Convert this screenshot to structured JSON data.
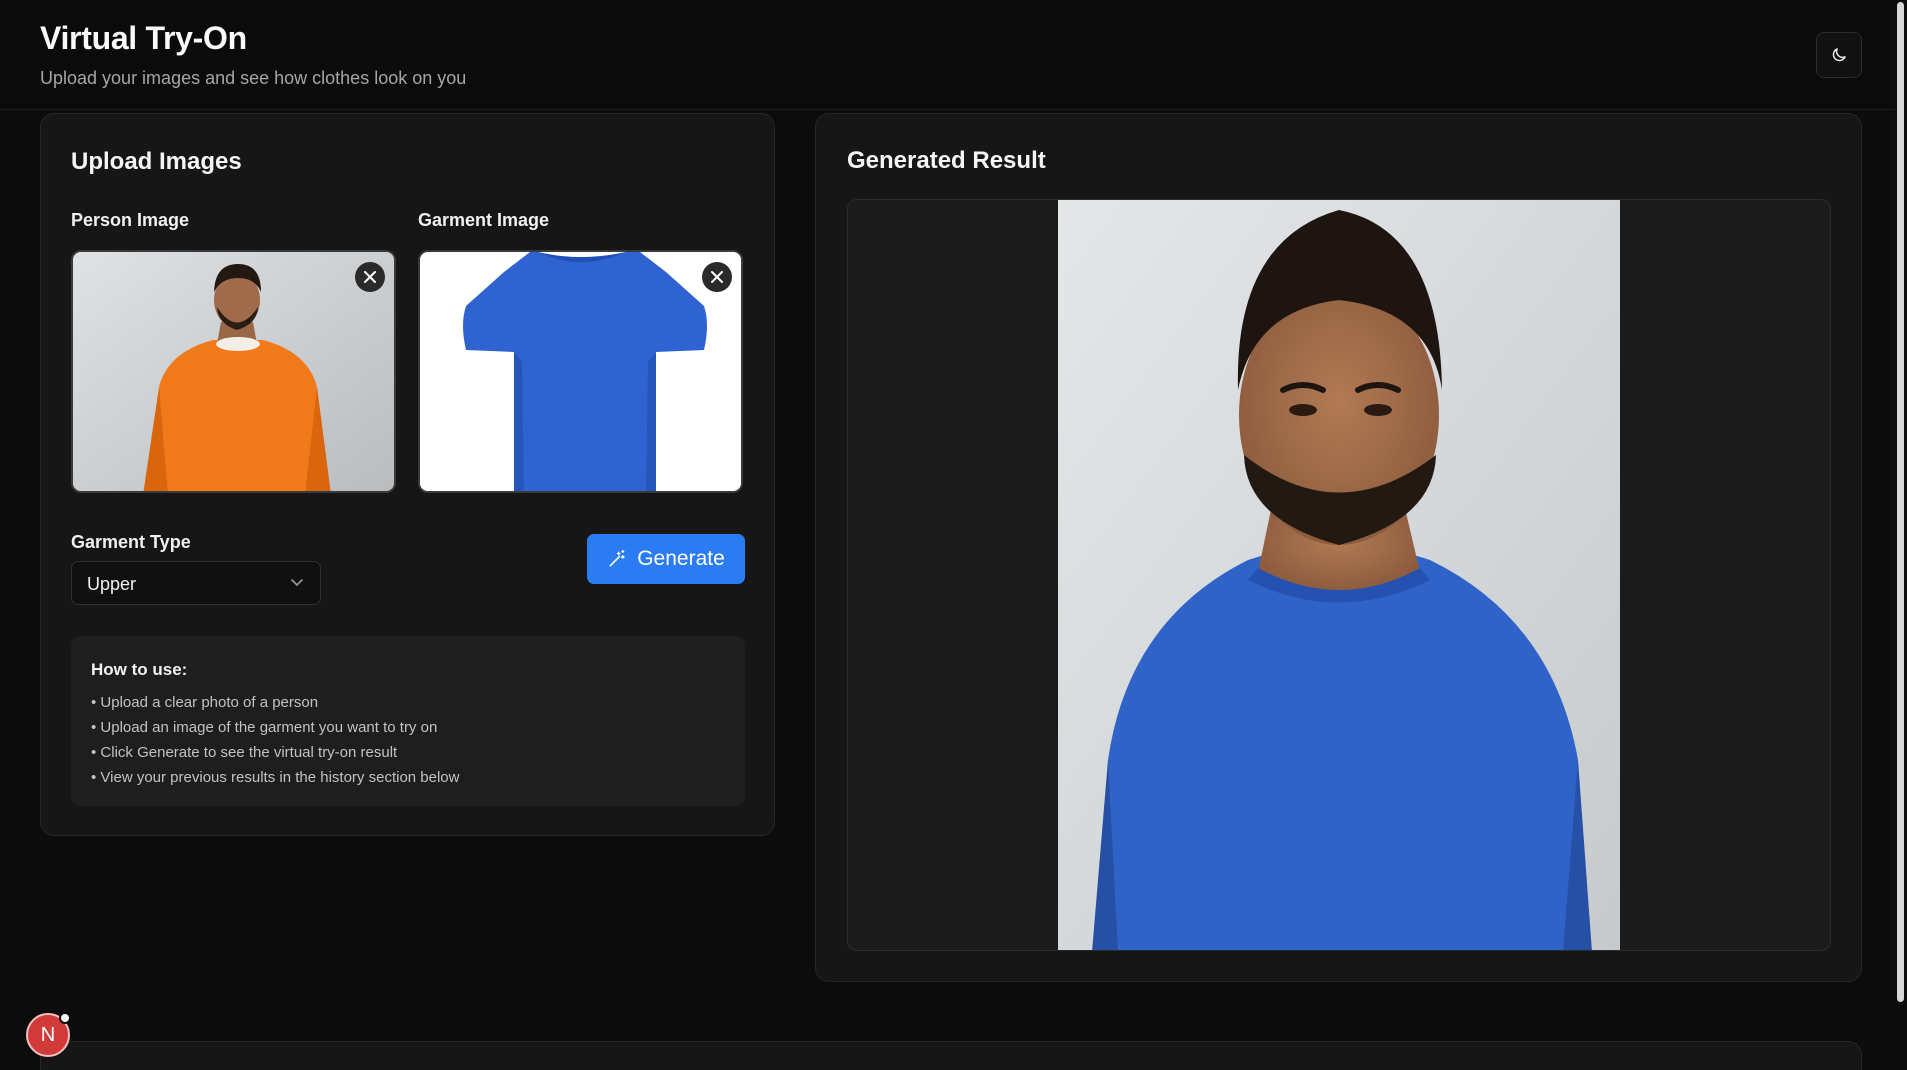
{
  "header": {
    "title": "Virtual Try-On",
    "subtitle": "Upload your images and see how clothes look on you",
    "theme_toggle_icon": "moon-icon"
  },
  "upload": {
    "title": "Upload Images",
    "person_label": "Person Image",
    "garment_label": "Garment Image",
    "garment_type_label": "Garment Type",
    "garment_type_value": "Upper",
    "generate_label": "Generate",
    "howto": {
      "title": "How to use:",
      "items": [
        "Upload a clear photo of a person",
        "Upload an image of the garment you want to try on",
        "Click Generate to see the virtual try-on result",
        "View your previous results in the history section below"
      ]
    }
  },
  "result": {
    "title": "Generated Result"
  },
  "dev_badge": {
    "letter": "N"
  },
  "colors": {
    "accent": "#2b7cf3",
    "background": "#0c0c0c",
    "card": "#161616",
    "sweater": "#f07a1a",
    "shirt": "#2f63c8"
  }
}
